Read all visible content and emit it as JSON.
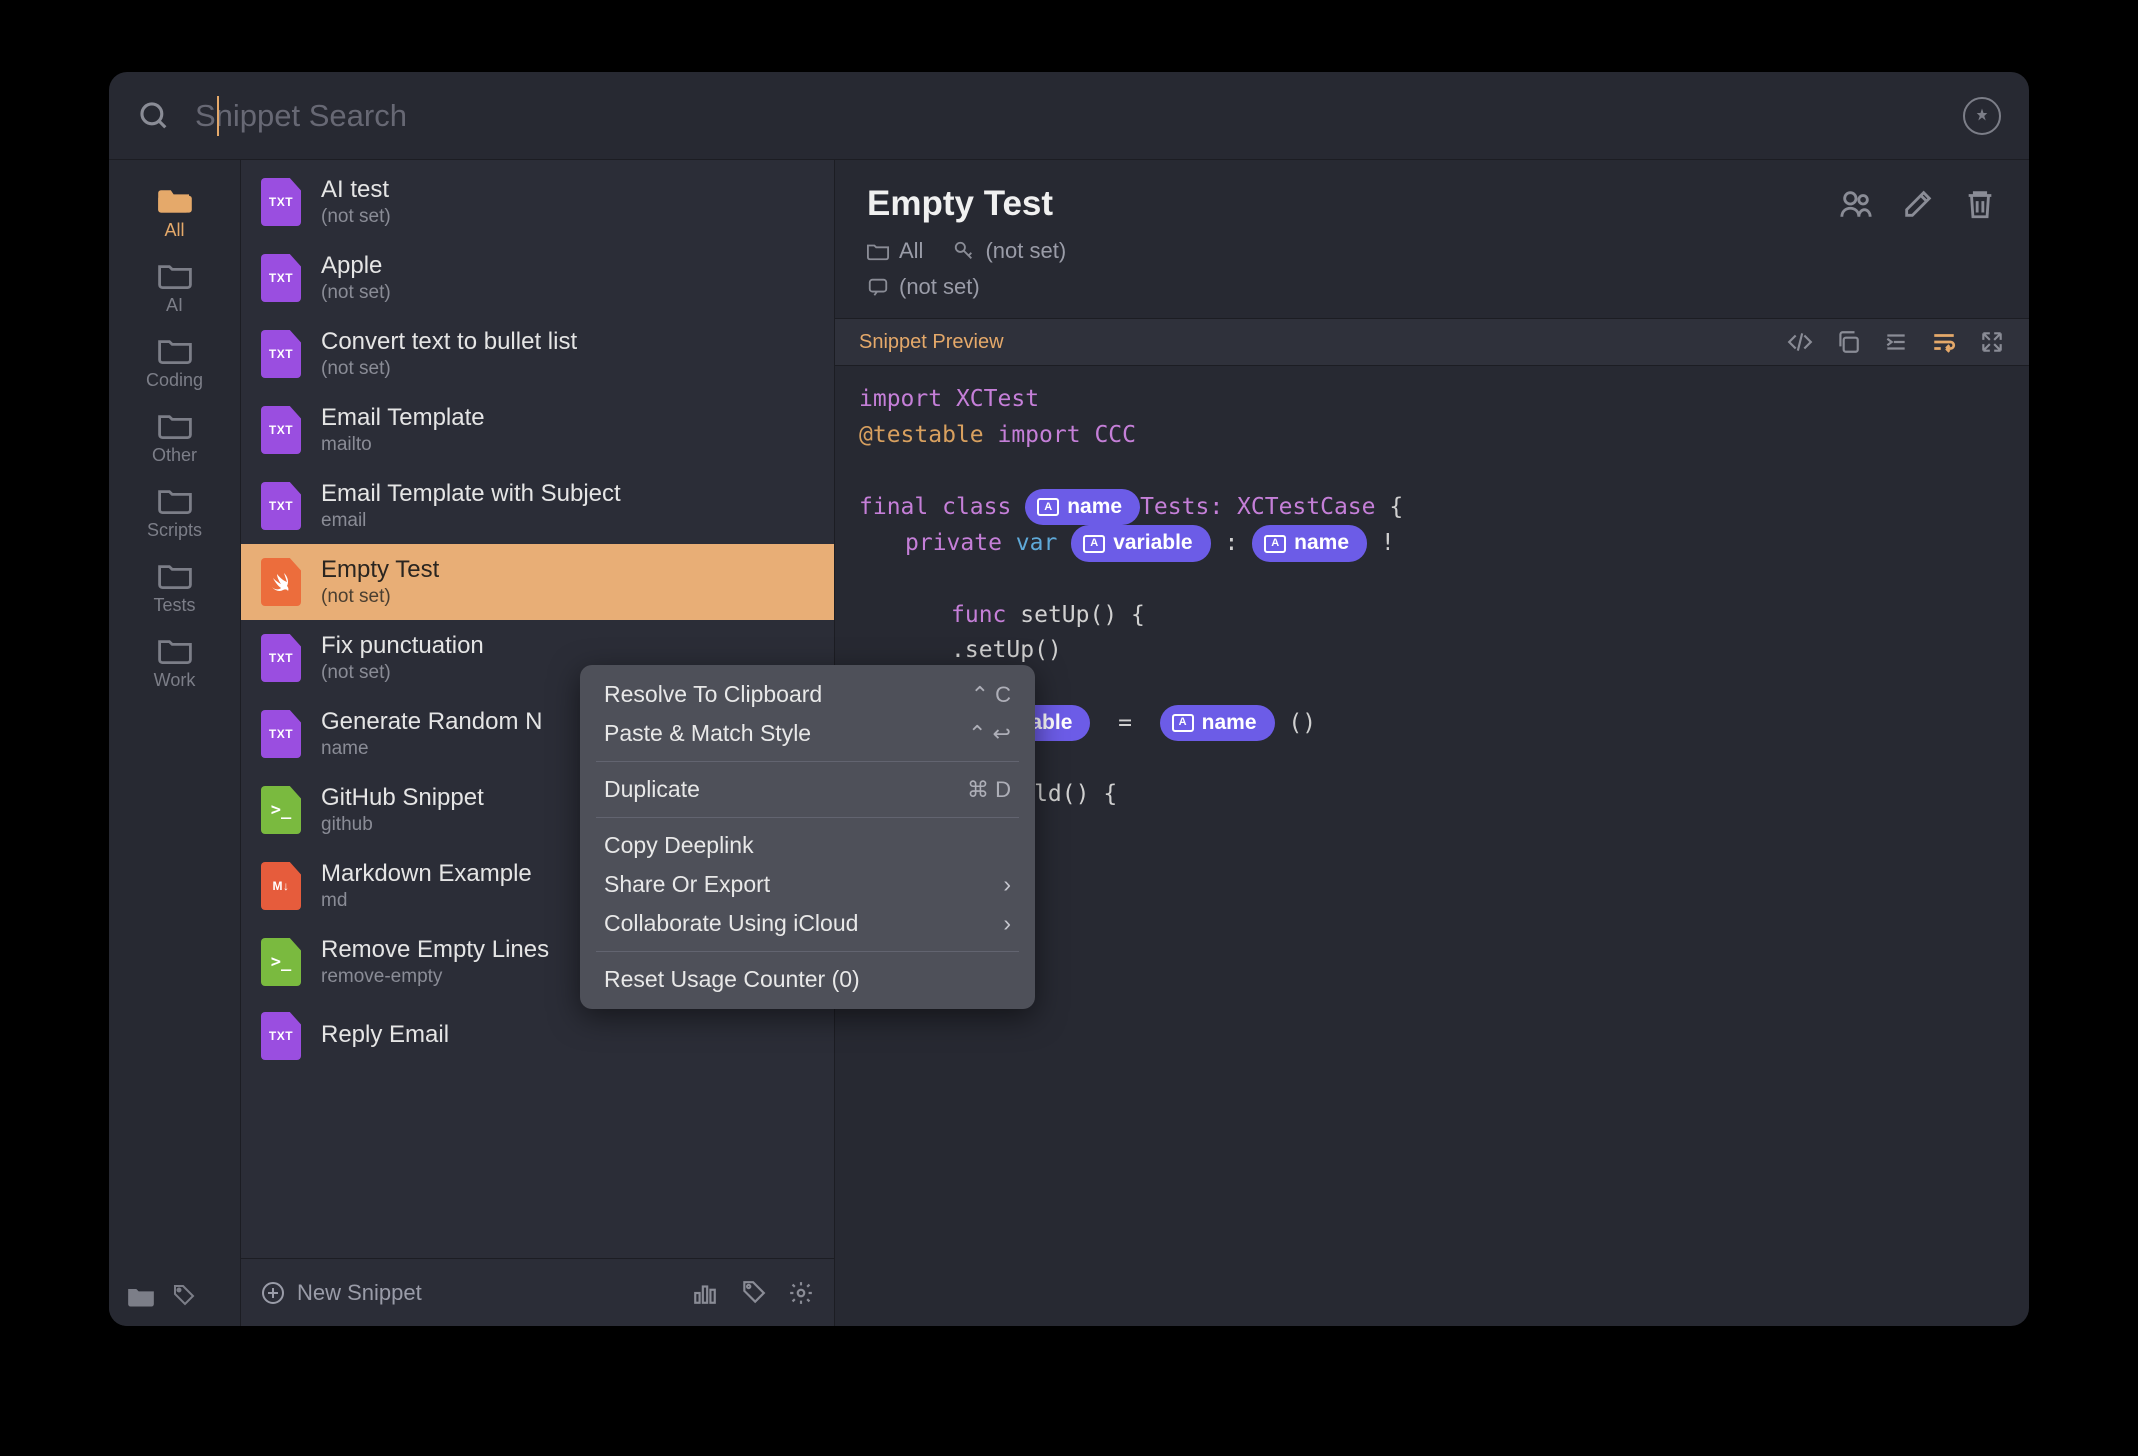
{
  "search": {
    "placeholder": "Snippet Search"
  },
  "sidebar": {
    "items": [
      {
        "label": "All",
        "active": true
      },
      {
        "label": "AI"
      },
      {
        "label": "Coding"
      },
      {
        "label": "Other"
      },
      {
        "label": "Scripts"
      },
      {
        "label": "Tests"
      },
      {
        "label": "Work"
      }
    ]
  },
  "snippets": [
    {
      "title": "AI test",
      "sub": "(not set)",
      "type": "txt"
    },
    {
      "title": "Apple",
      "sub": "(not set)",
      "type": "txt"
    },
    {
      "title": "Convert text to bullet list",
      "sub": "(not set)",
      "type": "txt"
    },
    {
      "title": "Email Template",
      "sub": "mailto",
      "type": "txt"
    },
    {
      "title": "Email Template with Subject",
      "sub": "email",
      "type": "txt"
    },
    {
      "title": "Empty Test",
      "sub": "(not set)",
      "type": "swift",
      "selected": true
    },
    {
      "title": "Fix punctuation",
      "sub": "(not set)",
      "type": "txt"
    },
    {
      "title": "Generate Random N",
      "sub": "name",
      "type": "txt"
    },
    {
      "title": "GitHub Snippet",
      "sub": "github",
      "type": "sh"
    },
    {
      "title": "Markdown Example",
      "sub": "md",
      "type": "md"
    },
    {
      "title": "Remove Empty Lines",
      "sub": "remove-empty",
      "type": "sh"
    },
    {
      "title": "Reply Email",
      "sub": "",
      "type": "txt"
    }
  ],
  "list_footer": {
    "new_label": "New Snippet"
  },
  "detail": {
    "title": "Empty Test",
    "folder": "All",
    "keyword": "(not set)",
    "note": "(not set)",
    "preview_label": "Snippet Preview"
  },
  "code": {
    "l1_import": "import",
    "l1_xctest": "XCTest",
    "l2_testable": "@testable",
    "l2_import": "import",
    "l2_ccc": "CCC",
    "l4_final": "final",
    "l4_class": "class",
    "pill_name": "name",
    "l4_tests": "Tests:",
    "l4_xctc": "XCTestCase",
    "l4_brace": "{",
    "l5_private": "private",
    "l5_var": "var",
    "pill_variable": "variable",
    "l5_colon": ":",
    "l5_bang": "!",
    "l7_func": "func",
    "l7_setup": "setUp() {",
    "l8_super": ".setUp()",
    "l10_eq": "=",
    "l10_paren": "()",
    "l12_should": "t_Should() {"
  },
  "context_menu": {
    "items": [
      {
        "label": "Resolve To Clipboard",
        "shortcut": "⌃ C"
      },
      {
        "label": "Paste & Match Style",
        "shortcut": "⌃ ↩"
      },
      {
        "sep": true
      },
      {
        "label": "Duplicate",
        "shortcut": "⌘ D"
      },
      {
        "sep": true
      },
      {
        "label": "Copy Deeplink"
      },
      {
        "label": "Share Or Export",
        "arrow": true
      },
      {
        "label": "Collaborate Using iCloud",
        "arrow": true
      },
      {
        "sep": true
      },
      {
        "label": "Reset Usage Counter (0)"
      }
    ]
  }
}
